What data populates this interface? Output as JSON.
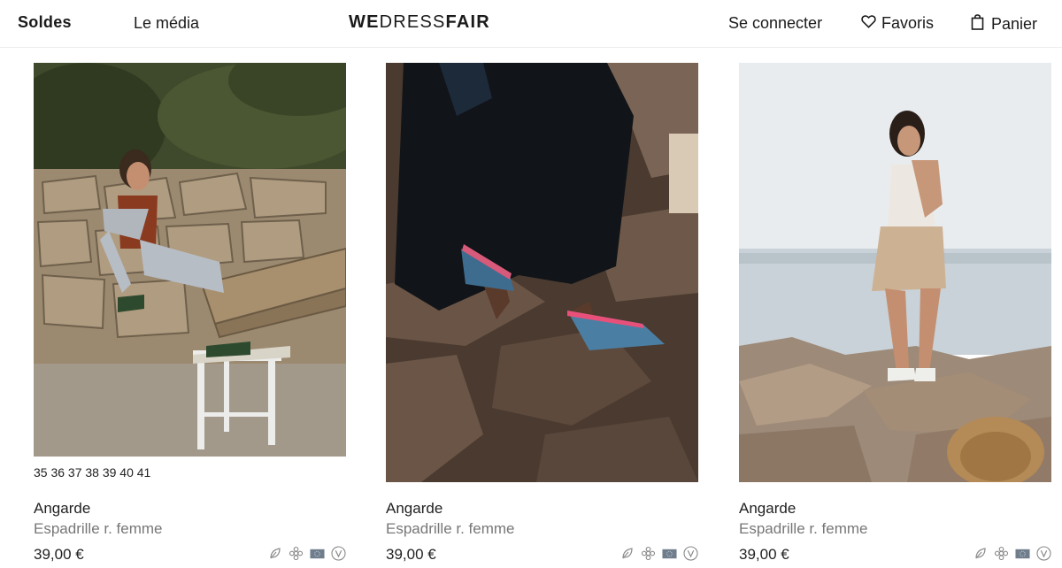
{
  "header": {
    "soldes": "Soldes",
    "media": "Le média",
    "logo_bold": "WE",
    "logo_light": "DRESS",
    "logo_bold2": "FAIR",
    "login": "Se connecter",
    "favorites": "Favoris",
    "cart": "Panier"
  },
  "products": [
    {
      "sizes": "35 36 37 38 39 40 41",
      "brand": "Angarde",
      "type": "Espadrille r. femme",
      "price": "39,00 €"
    },
    {
      "sizes": "",
      "brand": "Angarde",
      "type": "Espadrille r. femme",
      "price": "39,00 €"
    },
    {
      "sizes": "",
      "brand": "Angarde",
      "type": "Espadrille r. femme",
      "price": "39,00 €"
    }
  ],
  "badge_icons": [
    "leaf-icon",
    "flower-icon",
    "flag-icon",
    "vegan-icon"
  ],
  "colors": {
    "text": "#1a1a1a",
    "muted": "#777777",
    "border": "#ececec",
    "icon": "#8a8a8a"
  }
}
